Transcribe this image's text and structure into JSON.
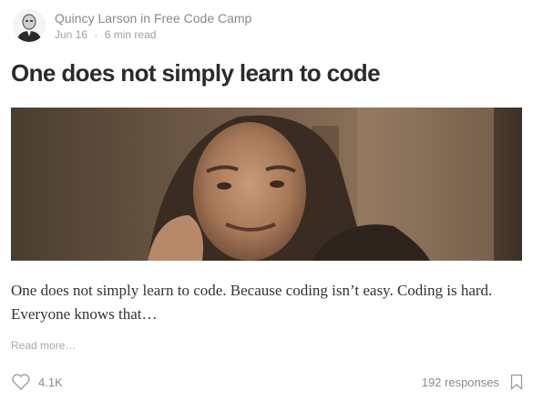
{
  "author": {
    "name": "Quincy Larson",
    "in_word": "in",
    "publication": "Free Code Camp",
    "date": "Jun 16",
    "separator": "·",
    "read_time": "6 min read"
  },
  "post": {
    "title": "One does not simply learn to code",
    "excerpt": "One does not simply learn to code. Because coding isn’t easy. Coding is hard. Everyone knows that…",
    "read_more": "Read more…"
  },
  "footer": {
    "recommend_count": "4.1K",
    "responses": "192 responses"
  },
  "icons": {
    "recommend": "heart-icon",
    "bookmark": "bookmark-icon"
  }
}
